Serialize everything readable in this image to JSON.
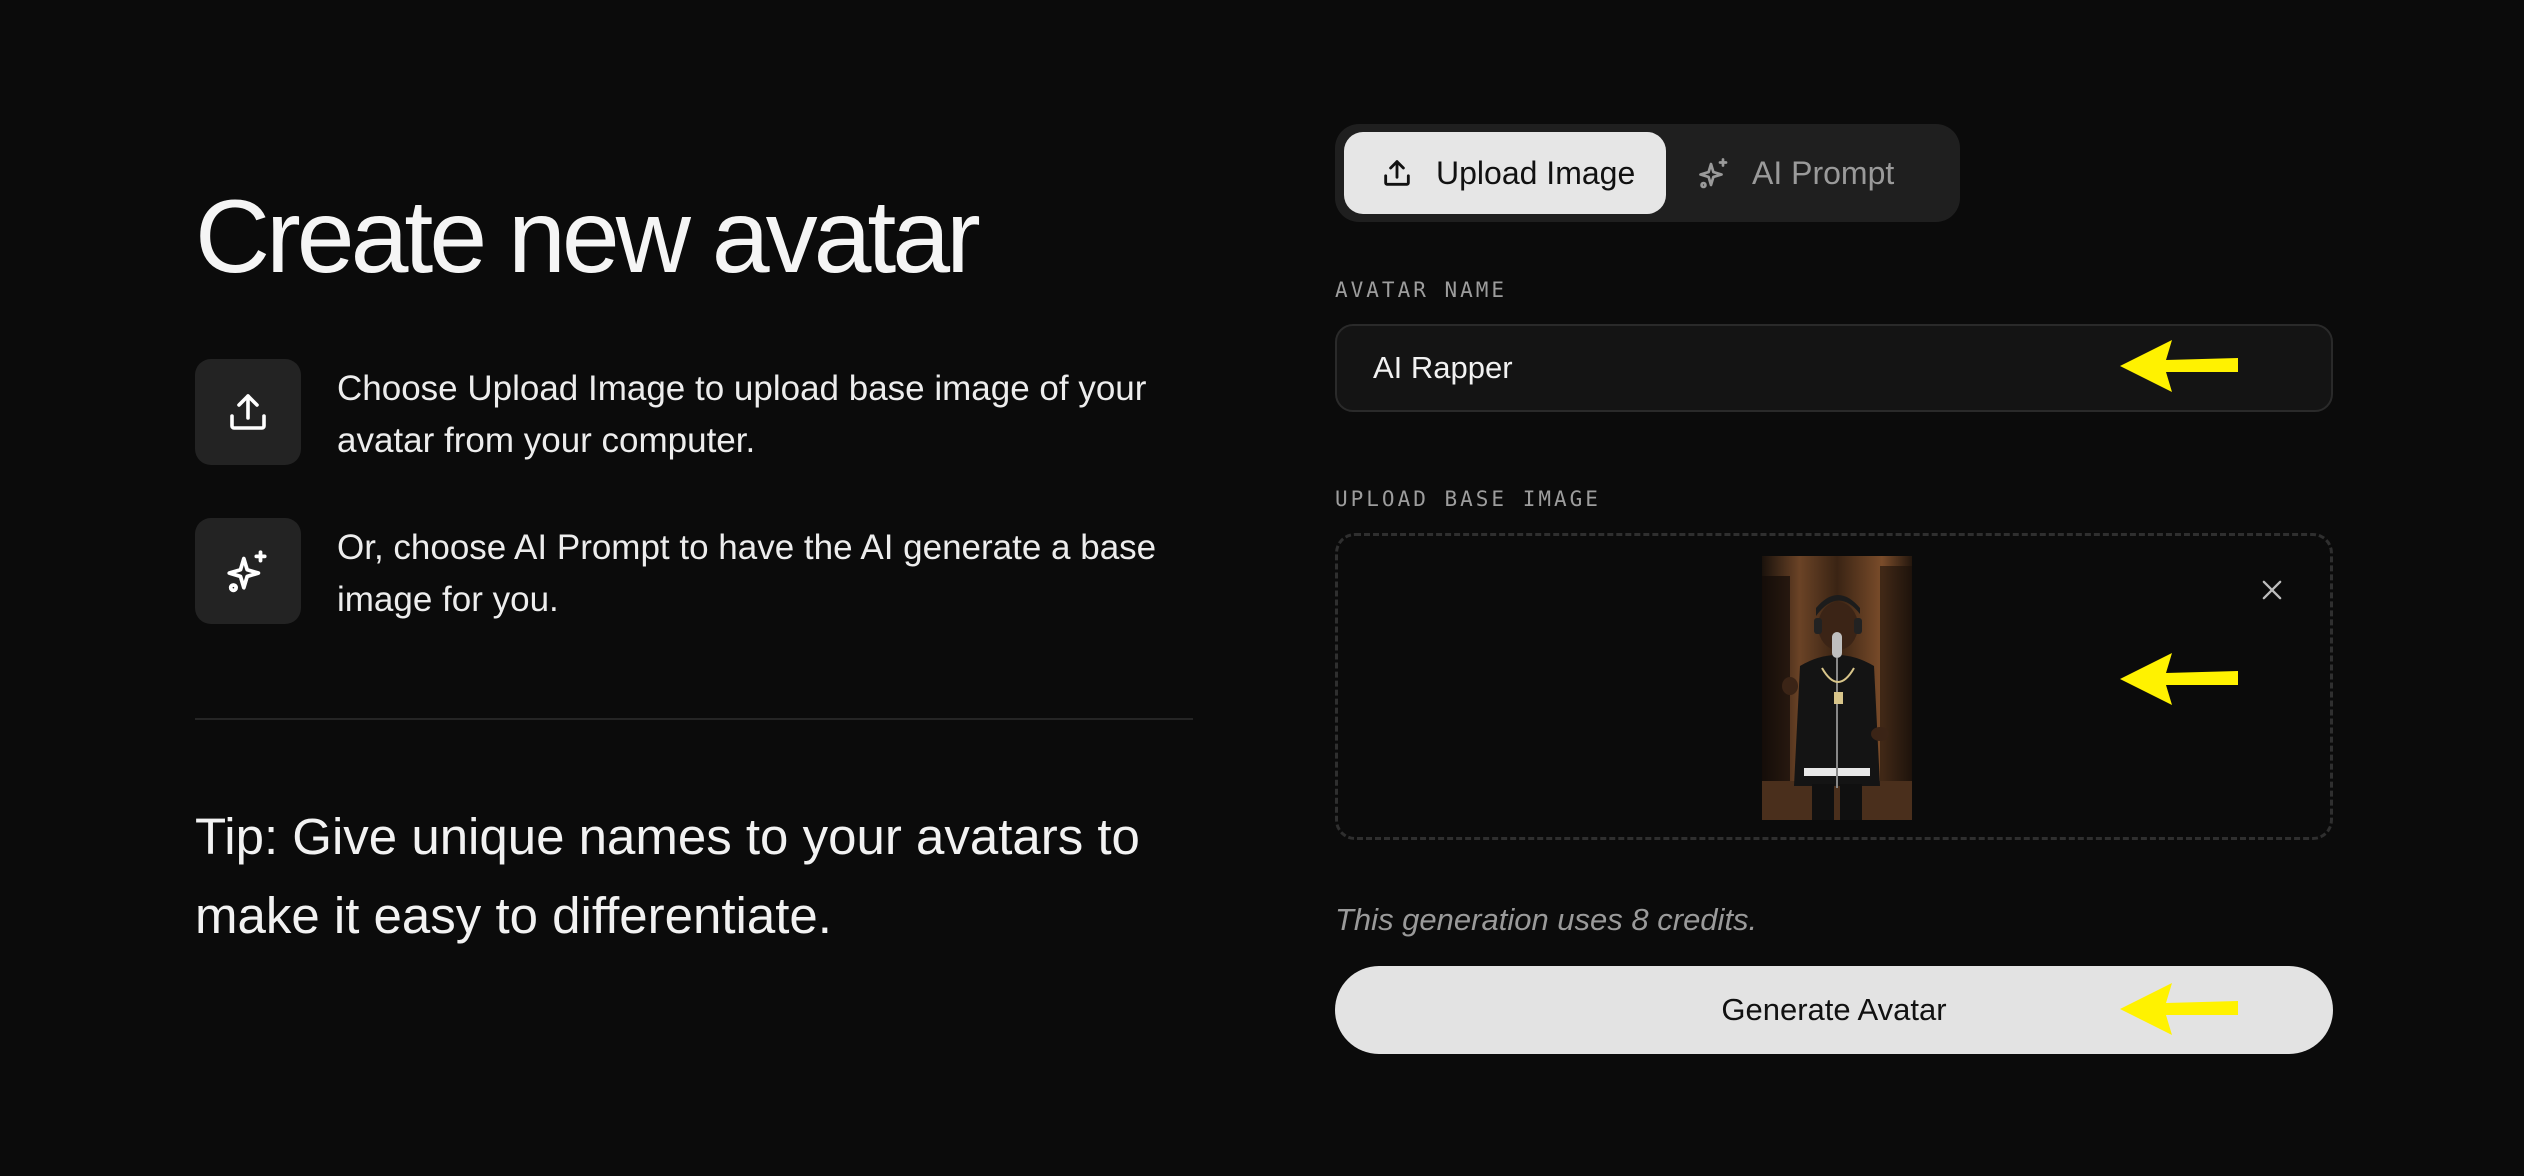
{
  "left": {
    "title": "Create new avatar",
    "features": [
      {
        "icon": "upload-icon",
        "text": "Choose Upload Image to upload base image of your avatar from your computer."
      },
      {
        "icon": "sparkle-icon",
        "text": "Or, choose AI Prompt to have the AI generate a base image for you."
      }
    ],
    "tip": "Tip: Give unique names to your avatars to make it easy to differentiate."
  },
  "tabs": {
    "selected": "Upload Image",
    "items": [
      {
        "label": "Upload Image",
        "icon": "upload-icon",
        "active": true
      },
      {
        "label": "AI Prompt",
        "icon": "sparkle-icon",
        "active": false
      }
    ]
  },
  "form": {
    "name_label": "AVATAR NAME",
    "name_value": "AI Rapper",
    "upload_label": "UPLOAD BASE IMAGE",
    "credits_text": "This generation uses 8 credits.",
    "generate_label": "Generate Avatar"
  },
  "colors": {
    "background": "#0b0b0b",
    "active_tab": "#e6e6e6",
    "button": "#e3e3e3",
    "annotation_arrow": "#fff200"
  }
}
